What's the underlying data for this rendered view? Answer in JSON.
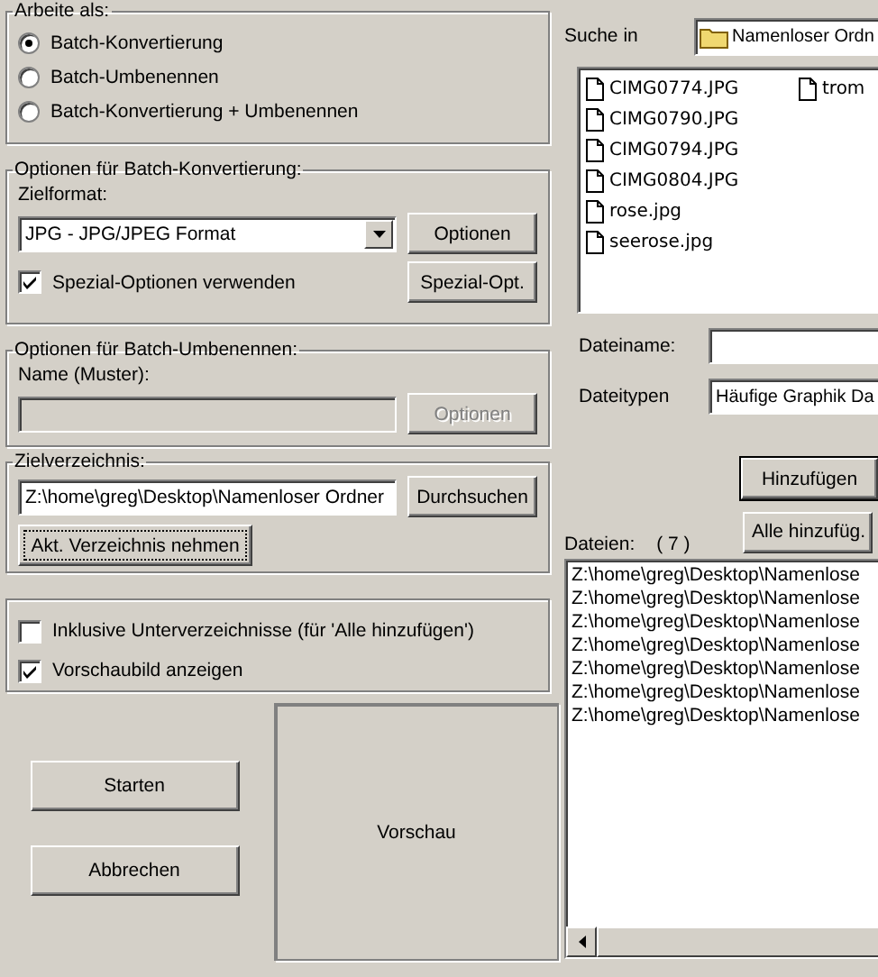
{
  "work_mode": {
    "legend": "Arbeite als:",
    "options": [
      {
        "label": "Batch-Konvertierung",
        "selected": true
      },
      {
        "label": "Batch-Umbenennen",
        "selected": false
      },
      {
        "label": "Batch-Konvertierung + Umbenennen",
        "selected": false
      }
    ]
  },
  "conversion": {
    "legend": "Optionen für Batch-Konvertierung:",
    "format_label": "Zielformat:",
    "format_value": "JPG - JPG/JPEG Format",
    "options_button": "Optionen",
    "special": {
      "label": "Spezial-Optionen verwenden",
      "checked": true
    },
    "special_button": "Spezial-Opt."
  },
  "renaming": {
    "legend": "Optionen für Batch-Umbenennen:",
    "name_label": "Name (Muster):",
    "options_button": {
      "label": "Optionen",
      "disabled": true
    }
  },
  "target": {
    "legend": "Zielverzeichnis:",
    "path": "Z:\\home\\greg\\Desktop\\Namenloser Ordner",
    "browse_button": "Durchsuchen",
    "current_button": "Akt. Verzeichnis nehmen"
  },
  "flags": [
    {
      "label": "Inklusive Unterverzeichnisse (für 'Alle hinzufügen')",
      "checked": false
    },
    {
      "label": "Vorschaubild anzeigen",
      "checked": true
    }
  ],
  "actions": [
    "Starten",
    "Abbrechen"
  ],
  "preview": {
    "label": "Vorschau"
  },
  "browser": {
    "look_in_label": "Suche in",
    "folder": "Namenloser Ordn",
    "files": [
      "CIMG0774.JPG",
      "CIMG0790.JPG",
      "CIMG0794.JPG",
      "CIMG0804.JPG",
      "rose.jpg",
      "seerose.jpg",
      "trom"
    ],
    "file_name_label": "Dateiname:",
    "file_types_label": "Dateitypen",
    "file_types_value": "Häufige Graphik Da",
    "add_button": "Hinzufügen",
    "count_label": "Dateien:",
    "count": "( 7 )",
    "add_all_button": "Alle hinzufüg.",
    "list": [
      "Z:\\home\\greg\\Desktop\\Namenlose",
      "Z:\\home\\greg\\Desktop\\Namenlose",
      "Z:\\home\\greg\\Desktop\\Namenlose",
      "Z:\\home\\greg\\Desktop\\Namenlose",
      "Z:\\home\\greg\\Desktop\\Namenlose",
      "Z:\\home\\greg\\Desktop\\Namenlose",
      "Z:\\home\\greg\\Desktop\\Namenlose"
    ]
  }
}
